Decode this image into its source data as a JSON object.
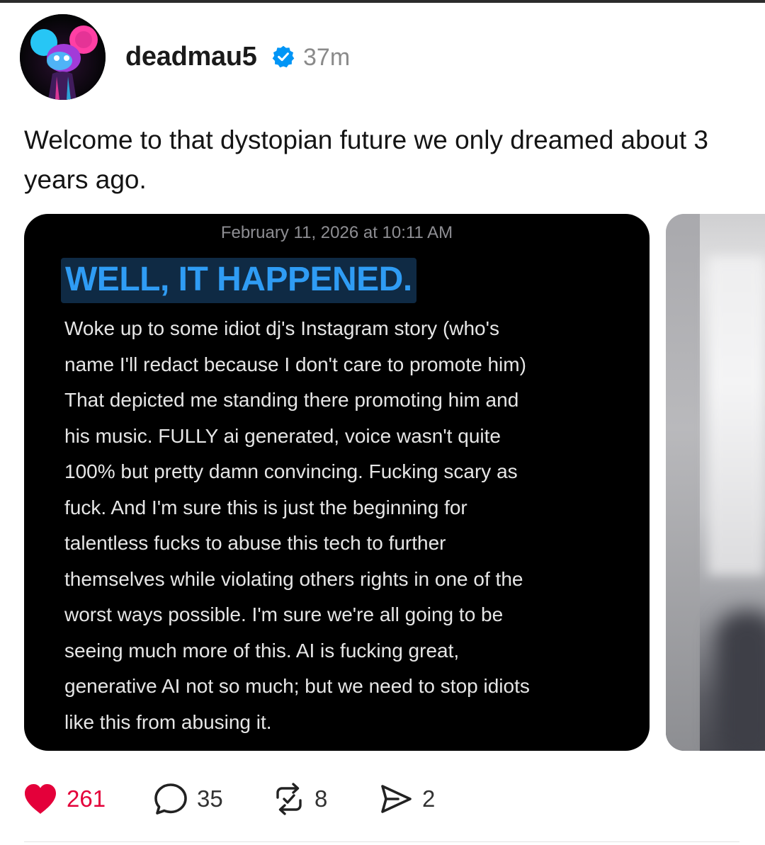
{
  "post": {
    "username": "deadmau5",
    "verified": true,
    "time_ago": "37m",
    "caption": "Welcome to that dystopian future we only dreamed about 3 years ago."
  },
  "screenshot": {
    "date": "February 11, 2026 at 10:11 AM",
    "title": "WELL, IT HAPPENED.",
    "body_lines": [
      "Woke up to some idiot dj's Instagram story (who's",
      "name I'll redact because I don't care to promote him)",
      "That depicted me standing there promoting him and",
      "his music. FULLY ai generated, voice wasn't quite",
      "100% but pretty damn convincing. Fucking scary as",
      "fuck. And I'm sure this is just the beginning for",
      "talentless fucks to abuse this tech to further",
      "themselves while violating others rights in one of the",
      "worst ways possible. I'm sure we're all going to be",
      "seeing much more of this. AI is fucking great,",
      "generative AI not so much; but we need to stop idiots",
      "like this from abusing it."
    ]
  },
  "actions": {
    "likes": "261",
    "comments": "35",
    "reposts": "8",
    "shares": "2",
    "liked": true
  },
  "colors": {
    "verified_blue": "#0095f6",
    "like_red": "#e4003a",
    "title_blue": "#2f9cf4"
  },
  "icons": [
    "heart-icon",
    "comment-icon",
    "repost-icon",
    "share-icon",
    "verified-badge-icon"
  ]
}
